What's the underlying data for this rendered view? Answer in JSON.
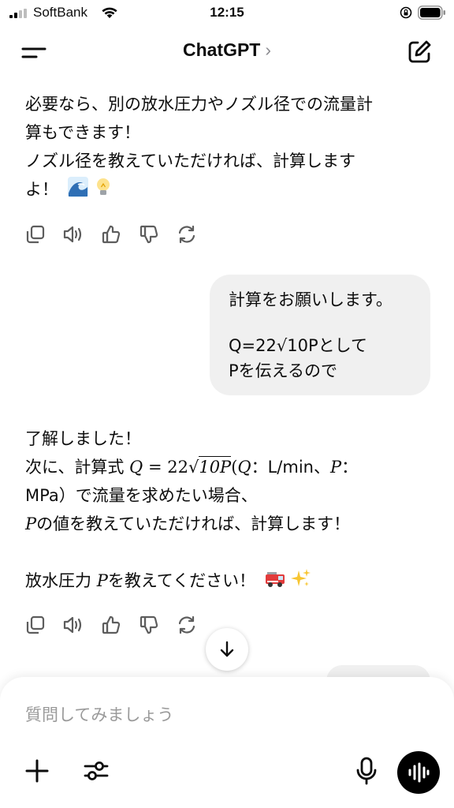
{
  "status_bar": {
    "carrier": "SoftBank",
    "time": "12:15"
  },
  "nav": {
    "title": "ChatGPT",
    "title_chevron": "›"
  },
  "messages": {
    "ai_1": {
      "lines": [
        "必要なら、別の放水圧力やノズル径での流量計",
        "算もできます！",
        "ノズル径を教えていただければ、計算します",
        "よ！"
      ],
      "emojis": [
        "wave-emoji",
        "light-bulb-emoji"
      ]
    },
    "user_1": {
      "line1": "計算をお願いします。",
      "line2_prefix": "Q=22",
      "line2_sqrt": "√",
      "line2_radicand": "10P",
      "line2_suffix": "として",
      "line3": "Pを伝えるので"
    },
    "ai_2": {
      "line1": "了解しました！",
      "line2_prefix": "次に、計算式 ",
      "formula_lhs": "Q",
      "formula_eq": " = 22",
      "formula_sqrt": "√",
      "formula_radicand": "10P",
      "line2_unit_open": "(",
      "unit_q_var": "Q",
      "unit_q": "：L/min、",
      "unit_p_var": "P",
      "unit_p_colon": "：",
      "line3": "MPa）で流量を求めたい場合、",
      "line4_var": "P",
      "line4": "の値を教えていただければ、計算します！",
      "line5_prefix": "放水圧力 ",
      "line5_var": "P",
      "line5": "を教えてください！",
      "emojis": [
        "fire-engine-emoji",
        "sparkles-emoji"
      ]
    }
  },
  "composer": {
    "placeholder": "質問してみましょう"
  },
  "colors": {
    "bubble": "#f0f0f0",
    "text": "#0d0d0d",
    "icon": "#5d5d5d",
    "placeholder": "#9a9a9a"
  }
}
